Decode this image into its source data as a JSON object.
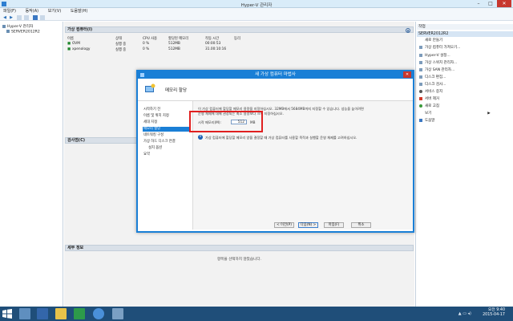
{
  "window": {
    "title": "Hyper-V 관리자",
    "min": "–",
    "max": "□",
    "close": "✕"
  },
  "menu": [
    "파일(F)",
    "동작(A)",
    "보기(V)",
    "도움말(H)"
  ],
  "tree": {
    "root": "Hyper-V 관리자",
    "server": "SERVER2012R2"
  },
  "vm_section": {
    "title": "가상 컴퓨터(I)",
    "columns": [
      "이름",
      "상태",
      "CPU 사용",
      "할당된 메모리",
      "작동 시간",
      "등리"
    ],
    "rows": [
      {
        "name": "OVM",
        "state": "실행 중",
        "cpu": "0 %",
        "mem": "512MB",
        "uptime": "00:00:53"
      },
      {
        "name": "xpenology",
        "state": "실행 중",
        "cpu": "0 %",
        "mem": "512MB",
        "uptime": "31.00:10:16"
      }
    ]
  },
  "checkpoint_section": {
    "title": "검사점(C)"
  },
  "detail_section": {
    "title": "세부 정보",
    "message": "항목을 선택하지 않았습니다."
  },
  "actions": {
    "header": "작업",
    "server_header": "SERVER2012R2",
    "items": [
      "새로 만들기",
      "가상 컴퓨터 가져오기...",
      "Hyper-V 설정...",
      "가상 스위치 관리자...",
      "가상 SAN 관리자...",
      "디스크 편집...",
      "디스크 검사...",
      "서비스 중지",
      "서버 제거",
      "새로 고침",
      "보기",
      "도움말"
    ]
  },
  "wizard": {
    "title": "새 가상 컴퓨터 마법사",
    "close": "✕",
    "heading": "메모리 할당",
    "nav": [
      "시작하기 전",
      "이름 및 위치 지정",
      "세대 지정",
      "메모리 할당",
      "네트워킹 구성",
      "가상 하드 디스크 연결",
      "설치 옵션",
      "요약"
    ],
    "selected_nav": 3,
    "body_line1": "이 가상 컴퓨터에 할당할 메모리 용량을 지정하십시오. 32MB에서 5684MB까지 지정할 수 있습니다. 성능을 높이려면",
    "body_line2": "운영 체제에 대해 권장되는 최소 용량보다 크게 지정하십시오.",
    "memory_label": "시작 메모리(M):",
    "memory_value": "512",
    "memory_unit": "MB",
    "info": "가상 컴퓨터에 할당할 메모리 양을 결정할 때 가상 컴퓨터를 사용할 목적과 실행할 운영 체제를 고려하십시오.",
    "buttons": {
      "prev": "< 이전(P)",
      "next": "다음(N) >",
      "finish": "마침(F)",
      "cancel": "취소"
    }
  },
  "taskbar": {
    "time": "오전 9:40",
    "date": "2015-04-17"
  }
}
